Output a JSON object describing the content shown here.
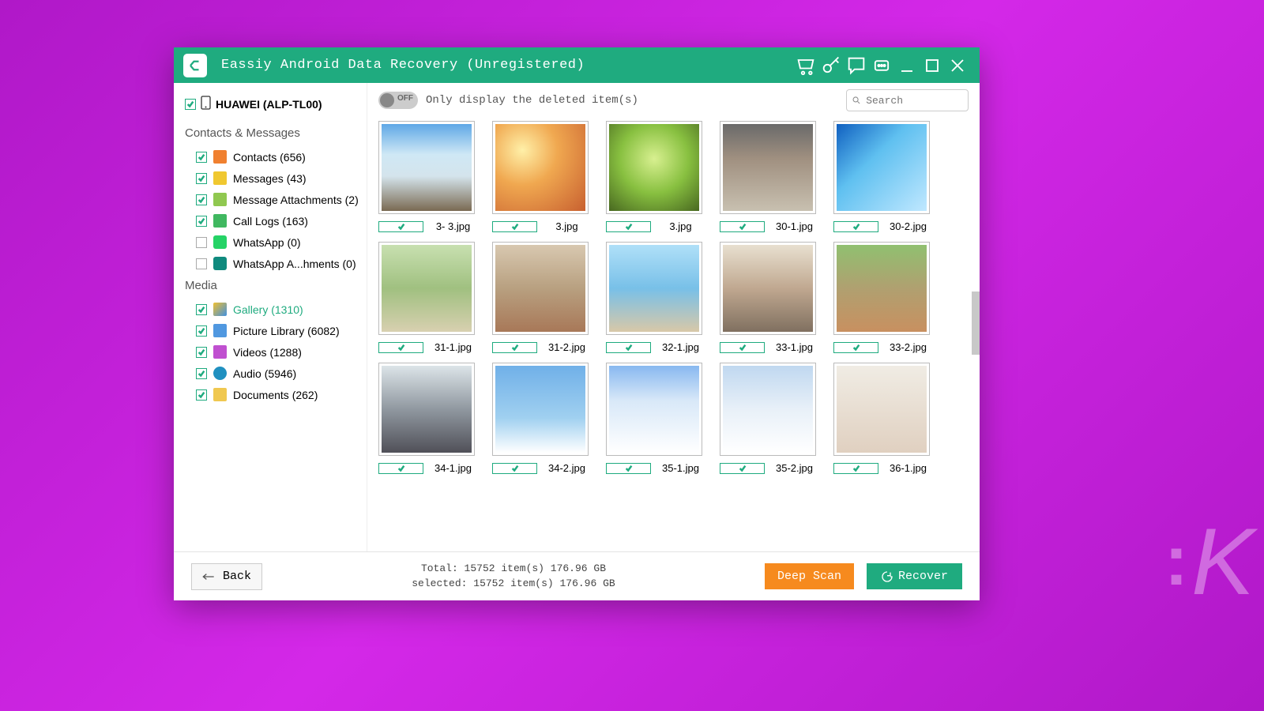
{
  "app": {
    "title": "Eassiy Android Data Recovery (Unregistered)"
  },
  "device": {
    "name": "HUAWEI (ALP-TL00)"
  },
  "sidebar": {
    "section1": "Contacts & Messages",
    "section2": "Media",
    "items": {
      "contacts": {
        "label": "Contacts (656)",
        "checked": true
      },
      "messages": {
        "label": "Messages (43)",
        "checked": true
      },
      "msgattach": {
        "label": "Message Attachments (2)",
        "checked": true
      },
      "calllogs": {
        "label": "Call Logs (163)",
        "checked": true
      },
      "whatsapp": {
        "label": "WhatsApp (0)",
        "checked": false
      },
      "whatsatt": {
        "label": "WhatsApp A...hments (0)",
        "checked": false
      },
      "gallery": {
        "label": "Gallery (1310)",
        "checked": true
      },
      "piclib": {
        "label": "Picture Library (6082)",
        "checked": true
      },
      "videos": {
        "label": "Videos (1288)",
        "checked": true
      },
      "audio": {
        "label": "Audio (5946)",
        "checked": true
      },
      "documents": {
        "label": "Documents (262)",
        "checked": true
      }
    }
  },
  "toolbar": {
    "toggle_off": "OFF",
    "toggle_label": "Only display the deleted item(s)",
    "search_placeholder": "Search"
  },
  "thumbs": [
    {
      "file": "3- 3.jpg",
      "cls": "img-snowboard"
    },
    {
      "file": "3.jpg",
      "cls": "img-sunset-run"
    },
    {
      "file": "3.jpg",
      "cls": "img-handstand-green"
    },
    {
      "file": "30-1.jpg",
      "cls": "img-legs"
    },
    {
      "file": "30-2.jpg",
      "cls": "img-surf"
    },
    {
      "file": "31-1.jpg",
      "cls": "img-path-run"
    },
    {
      "file": "31-2.jpg",
      "cls": "img-start"
    },
    {
      "file": "32-1.jpg",
      "cls": "img-beach-sit"
    },
    {
      "file": "33-1.jpg",
      "cls": "img-drink"
    },
    {
      "file": "33-2.jpg",
      "cls": "img-track-sit"
    },
    {
      "file": "34-1.jpg",
      "cls": "img-rocks"
    },
    {
      "file": "34-2.jpg",
      "cls": "img-sailing"
    },
    {
      "file": "35-1.jpg",
      "cls": "img-snowboard2"
    },
    {
      "file": "35-2.jpg",
      "cls": "img-ski"
    },
    {
      "file": "36-1.jpg",
      "cls": "img-stretch"
    }
  ],
  "footer": {
    "back": "Back",
    "total": "Total: 15752 item(s) 176.96 GB",
    "selected": "selected: 15752 item(s) 176.96 GB",
    "deep_scan": "Deep Scan",
    "recover": "Recover"
  }
}
